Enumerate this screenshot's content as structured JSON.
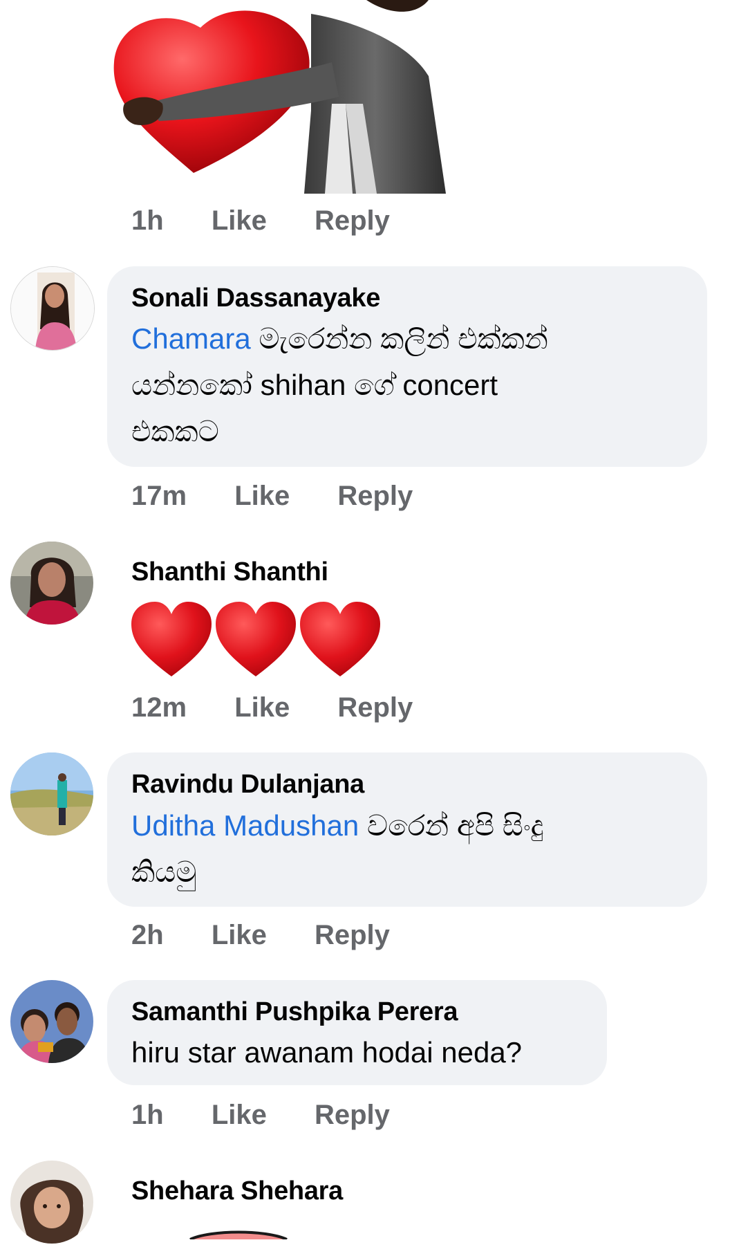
{
  "sticker_comment": {
    "time": "1h",
    "like": "Like",
    "reply": "Reply"
  },
  "comments": [
    {
      "author": "Sonali Dassanayake",
      "mention": "Chamara",
      "lines": [
        " මැරෙන්න කලින් එක්කන්",
        "යන්නකෝ shihan ගේ concert",
        "එකකට"
      ],
      "time": "17m",
      "like": "Like",
      "reply": "Reply"
    },
    {
      "author": "Shanthi Shanthi",
      "emoji": "❤️❤️❤️",
      "time": "12m",
      "like": "Like",
      "reply": "Reply"
    },
    {
      "author": "Ravindu Dulanjana",
      "mention": "Uditha Madushan",
      "lines": [
        " වරෙන් අපි සිංදු",
        "කියමු"
      ],
      "time": "2h",
      "like": "Like",
      "reply": "Reply"
    },
    {
      "author": "Samanthi Pushpika Perera",
      "lines": [
        "hiru star awanam hodai neda?"
      ],
      "time": "1h",
      "like": "Like",
      "reply": "Reply"
    },
    {
      "author": "Shehara Shehara"
    }
  ],
  "colors": {
    "mention": "#216fdb",
    "bubble": "#f0f2f5",
    "meta": "#65676b"
  }
}
